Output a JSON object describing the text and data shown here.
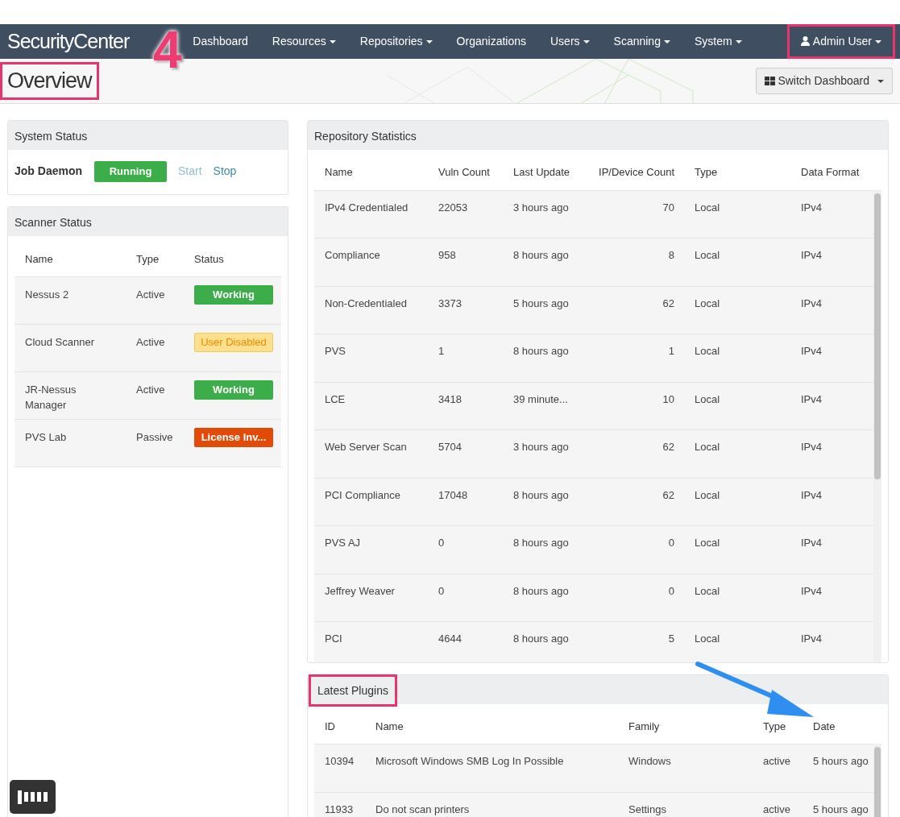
{
  "navbar": {
    "brand": "SecurityCenter",
    "items": [
      {
        "label": "Dashboard",
        "dropdown": false
      },
      {
        "label": "Resources",
        "dropdown": true
      },
      {
        "label": "Repositories",
        "dropdown": true
      },
      {
        "label": "Organizations",
        "dropdown": false
      },
      {
        "label": "Users",
        "dropdown": true
      },
      {
        "label": "Scanning",
        "dropdown": true
      },
      {
        "label": "System",
        "dropdown": true
      }
    ],
    "user": {
      "label": "Admin User",
      "highlighted": true
    }
  },
  "header": {
    "title": "Overview",
    "highlighted": true,
    "switch_button": "Switch Dashboard"
  },
  "annotation": {
    "step": "4"
  },
  "system_status": {
    "title": "System Status",
    "label": "Job Daemon",
    "status": "Running",
    "start": {
      "label": "Start",
      "disabled": true
    },
    "stop": {
      "label": "Stop",
      "disabled": false
    }
  },
  "scanner_status": {
    "title": "Scanner Status",
    "columns": [
      "Name",
      "Type",
      "Status"
    ],
    "rows": [
      {
        "name": "Nessus 2",
        "type": "Active",
        "status": "Working",
        "kind": "ok"
      },
      {
        "name": "Cloud Scanner",
        "type": "Active",
        "status": "User Disabled",
        "kind": "warning"
      },
      {
        "name": "JR-Nessus Manager",
        "type": "Active",
        "status": "Working",
        "kind": "ok"
      },
      {
        "name": "PVS Lab",
        "type": "Passive",
        "status": "License Inv...",
        "kind": "error"
      }
    ]
  },
  "repository_statistics": {
    "title": "Repository Statistics",
    "columns": [
      "Name",
      "Vuln Count",
      "Last Update",
      "IP/Device Count",
      "Type",
      "Data Format"
    ],
    "rows": [
      [
        "IPv4 Credentialed",
        "22053",
        "3 hours ago",
        "70",
        "Local",
        "IPv4"
      ],
      [
        "Compliance",
        "958",
        "8 hours ago",
        "8",
        "Local",
        "IPv4"
      ],
      [
        "Non-Credentialed",
        "3373",
        "5 hours ago",
        "62",
        "Local",
        "IPv4"
      ],
      [
        "PVS",
        "1",
        "8 hours ago",
        "1",
        "Local",
        "IPv4"
      ],
      [
        "LCE",
        "3418",
        "39 minute...",
        "10",
        "Local",
        "IPv4"
      ],
      [
        "Web Server Scan",
        "5704",
        "3 hours ago",
        "62",
        "Local",
        "IPv4"
      ],
      [
        "PCI Compliance",
        "17048",
        "8 hours ago",
        "62",
        "Local",
        "IPv4"
      ],
      [
        "PVS AJ",
        "0",
        "8 hours ago",
        "0",
        "Local",
        "IPv4"
      ],
      [
        "Jeffrey Weaver",
        "0",
        "8 hours ago",
        "0",
        "Local",
        "IPv4"
      ],
      [
        "PCI",
        "4644",
        "8 hours ago",
        "5",
        "Local",
        "IPv4"
      ]
    ]
  },
  "latest_plugins": {
    "title": "Latest Plugins",
    "highlighted": true,
    "columns": [
      "ID",
      "Name",
      "Family",
      "Type",
      "Date"
    ],
    "rows": [
      [
        "10394",
        "Microsoft Windows SMB Log In Possible",
        "Windows",
        "active",
        "5 hours ago"
      ],
      [
        "11933",
        "Do not scan printers",
        "Settings",
        "active",
        "5 hours ago"
      ]
    ]
  }
}
